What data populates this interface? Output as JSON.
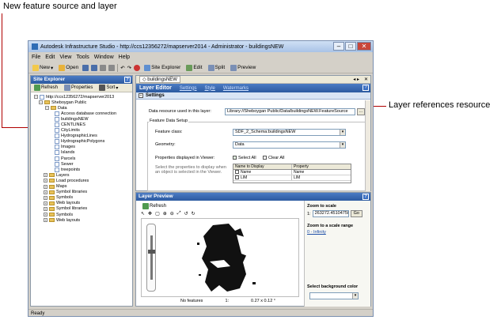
{
  "annotations": {
    "top_left": "New feature source and layer",
    "right": "Layer references resource"
  },
  "colors": {
    "callout_line": "#b00000",
    "accent": "#2c5aa0"
  },
  "window": {
    "title": "Autodesk Infrastructure Studio - http://ccs12356272/mapserver2014 - Administrator - buildingsNEW",
    "buttons": {
      "minimize": "–",
      "maximize": "□",
      "close": "✕"
    }
  },
  "menu": [
    "File",
    "Edit",
    "View",
    "Tools",
    "Window",
    "Help"
  ],
  "toolbar": {
    "new": "New",
    "open": "Open",
    "site_explorer": "Site Explorer",
    "edit": "Edit",
    "split": "Split",
    "preview": "Preview"
  },
  "site_explorer": {
    "title": "Site Explorer",
    "refresh": "Refresh",
    "properties": "Properties",
    "sort": "Sort",
    "tree": [
      {
        "label": "http://ccs12356272/mapserver2013",
        "type": "root"
      },
      {
        "label": "Sheboygan Public",
        "type": "folder"
      },
      {
        "label": "Data",
        "type": "folder"
      },
      {
        "label": "Access database connection",
        "type": "doc"
      },
      {
        "label": "buildingsNEW",
        "type": "doc"
      },
      {
        "label": "CENTLINES",
        "type": "doc"
      },
      {
        "label": "CityLimits",
        "type": "doc"
      },
      {
        "label": "HydrographicLines",
        "type": "doc"
      },
      {
        "label": "HydrographicPolygons",
        "type": "doc"
      },
      {
        "label": "Images",
        "type": "doc"
      },
      {
        "label": "Islands",
        "type": "doc"
      },
      {
        "label": "Parcels",
        "type": "doc"
      },
      {
        "label": "Sewer",
        "type": "doc"
      },
      {
        "label": "treepoints",
        "type": "doc"
      },
      {
        "label": "Layers",
        "type": "folder"
      },
      {
        "label": "Load procedures",
        "type": "folder"
      },
      {
        "label": "Maps",
        "type": "folder"
      },
      {
        "label": "Symbol libraries",
        "type": "folder"
      },
      {
        "label": "Symbols",
        "type": "folder"
      },
      {
        "label": "Web layouts",
        "type": "folder"
      },
      {
        "label": "Symbol libraries",
        "type": "folder"
      },
      {
        "label": "Symbols",
        "type": "folder"
      },
      {
        "label": "Web layouts",
        "type": "folder"
      }
    ]
  },
  "editor": {
    "tab": "buildingsNEW",
    "title": "Layer Editor",
    "links": [
      "Settings",
      "Style",
      "Watermarks"
    ],
    "section": "Settings",
    "resource_label": "Data resource used in this layer:",
    "resource_value": "Library://Sheboygan Public/Data/buildingsNEW.FeatureSource",
    "browse": "...",
    "group_title": "Feature Data Setup",
    "feature_class_label": "Feature class:",
    "feature_class_value": "SDF_2_Schema:buildingsNEW",
    "geometry_label": "Geometry:",
    "geometry_value": "Data",
    "props_label": "Properties displayed in Viewer:",
    "select_all": "Select All",
    "clear_all": "Clear All",
    "select_hint": "Select the properties to display when an object is selected in the Viewer.",
    "grid_headers": [
      "Name to Display",
      "Property"
    ],
    "grid_rows": [
      [
        "Name",
        "Name"
      ],
      [
        "LIM",
        "LIM"
      ]
    ]
  },
  "preview": {
    "title": "Layer Preview",
    "refresh": "Refresh",
    "zoom_scale_title": "Zoom to scale",
    "zoom_scale_prefix": "1:",
    "zoom_scale_value": "263272.451047505",
    "go": "Go",
    "zoom_range_title": "Zoom to a scale range",
    "zoom_range_value": "0 - Infinity",
    "bg_title": "Select background color",
    "no_features": "No features",
    "scale": "1:",
    "dims": "0.27 x 0.12 °"
  },
  "status": "Ready"
}
